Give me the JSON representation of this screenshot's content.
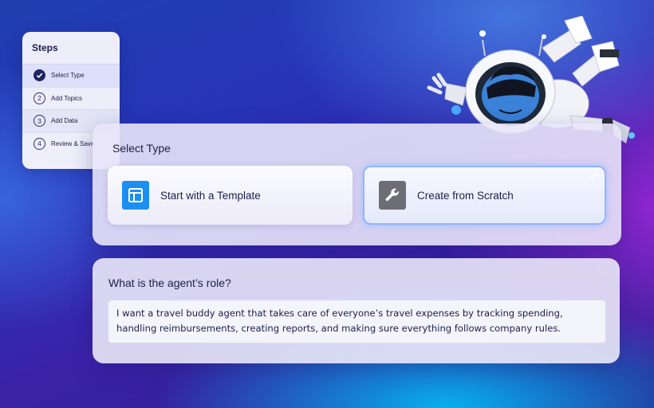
{
  "steps": {
    "title": "Steps",
    "items": [
      {
        "number": "",
        "label": "Select Type",
        "status": "done"
      },
      {
        "number": "2",
        "label": "Add Topics",
        "status": "pending"
      },
      {
        "number": "3",
        "label": "Add Data",
        "status": "pending"
      },
      {
        "number": "4",
        "label": "Review & Save",
        "status": "pending"
      }
    ]
  },
  "select_type": {
    "title": "Select Type",
    "options": [
      {
        "label": "Start with a Template",
        "icon": "template-icon",
        "selected": false
      },
      {
        "label": "Create from Scratch",
        "icon": "wrench-icon",
        "selected": true
      }
    ]
  },
  "role": {
    "title": "What is the agent’s role?",
    "value": "I want a travel buddy agent that takes care of everyone’s travel expenses by tracking spending, handling reimbursements, creating reports, and making sure everything follows company rules."
  },
  "colors": {
    "accent": "#1c8ef2",
    "selected_border": "#8fb6ff",
    "text_dark": "#1b1f4a"
  }
}
